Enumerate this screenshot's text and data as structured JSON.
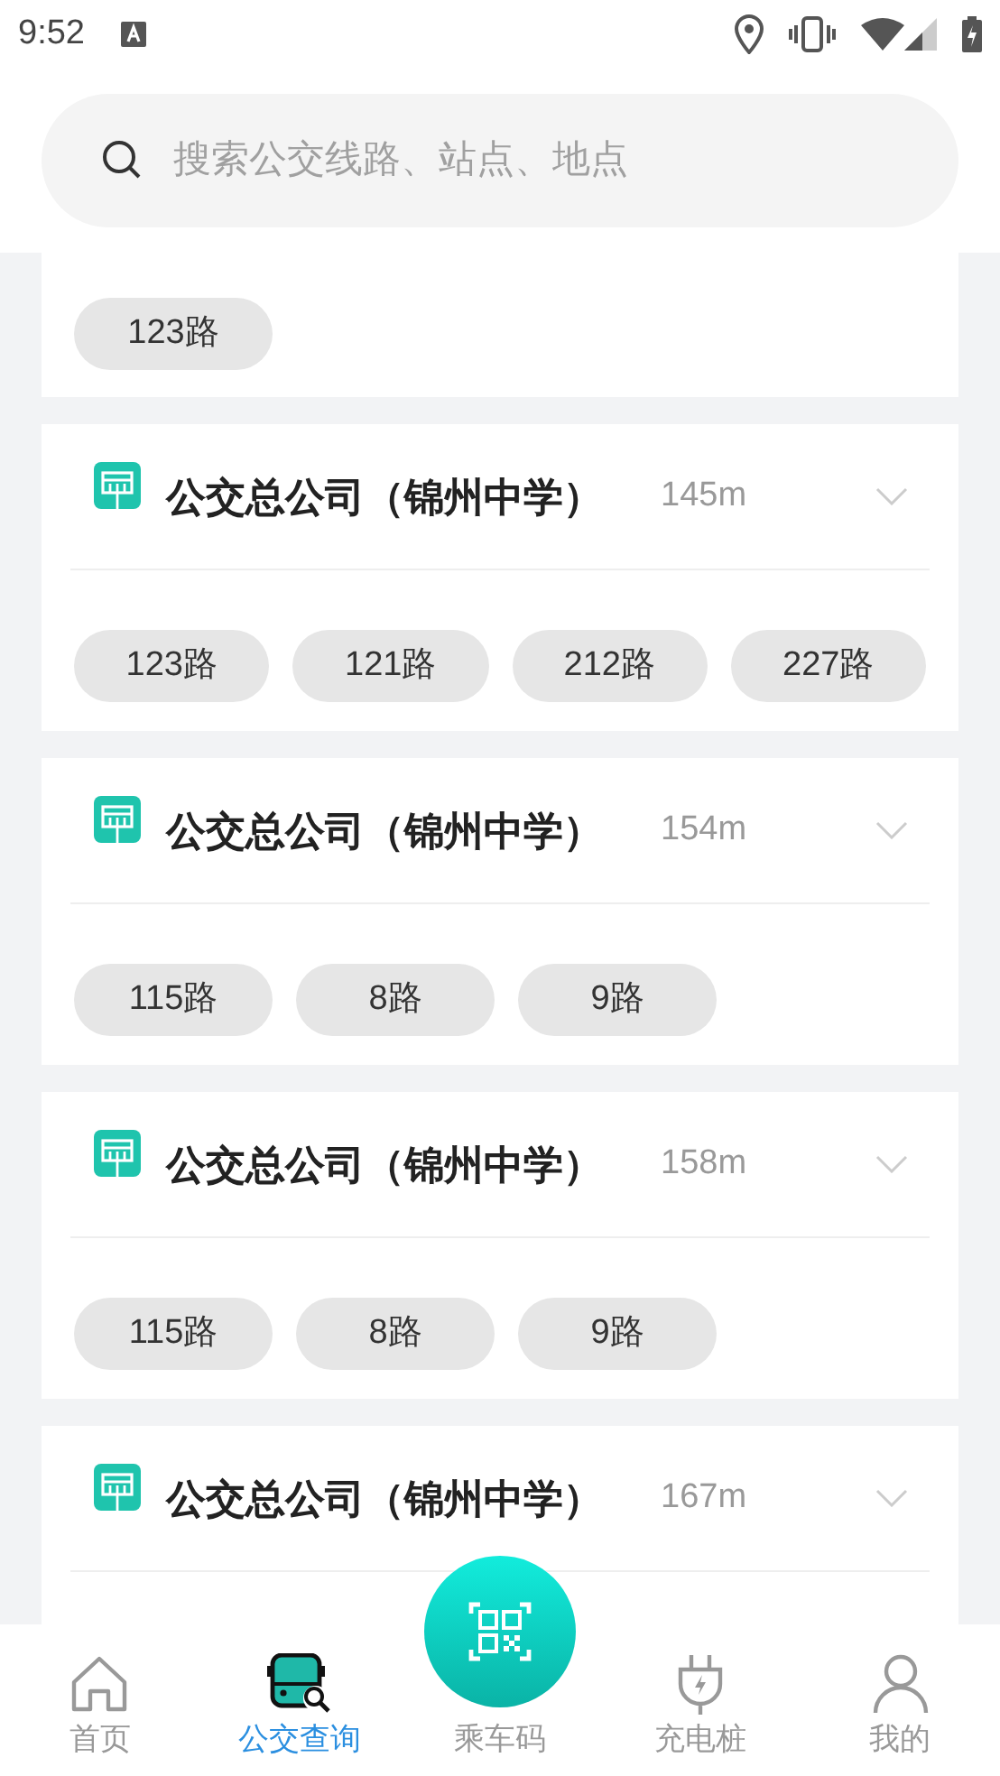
{
  "status_bar": {
    "time": "9:52"
  },
  "search": {
    "placeholder": "搜索公交线路、站点、地点"
  },
  "partial_card": {
    "routes": [
      "123路"
    ]
  },
  "stations": [
    {
      "name": "公交总公司（锦州中学）",
      "distance": "145m",
      "routes": [
        "123路",
        "121路",
        "212路",
        "227路"
      ]
    },
    {
      "name": "公交总公司（锦州中学）",
      "distance": "154m",
      "routes": [
        "115路",
        "8路",
        "9路"
      ]
    },
    {
      "name": "公交总公司（锦州中学）",
      "distance": "158m",
      "routes": [
        "115路",
        "8路",
        "9路"
      ]
    },
    {
      "name": "公交总公司（锦州中学）",
      "distance": "167m"
    }
  ],
  "nav": [
    {
      "kind": "home",
      "label": "首页",
      "selected": false
    },
    {
      "kind": "bus",
      "label": "公交查询",
      "selected": true
    },
    {
      "kind": "qr",
      "label": "乘车码",
      "selected": false
    },
    {
      "kind": "plug",
      "label": "充电桩",
      "selected": false
    },
    {
      "kind": "user",
      "label": "我的",
      "selected": false
    }
  ]
}
